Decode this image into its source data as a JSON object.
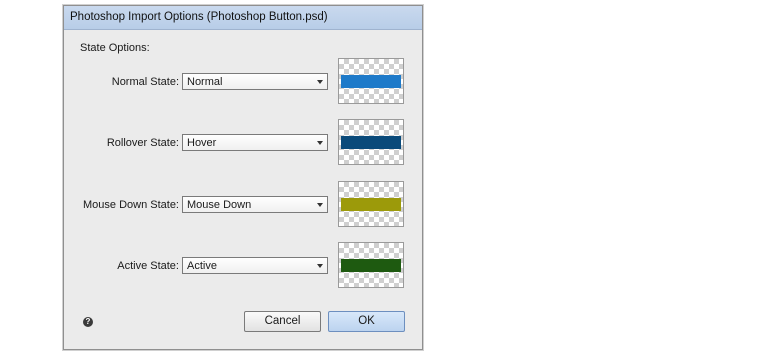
{
  "dialog": {
    "title": "Photoshop Import Options (Photoshop Button.psd)",
    "section_label": "State Options:"
  },
  "states": [
    {
      "label": "Normal State:",
      "value": "Normal",
      "swatch_color": "#1e7ac9"
    },
    {
      "label": "Rollover State:",
      "value": "Hover",
      "swatch_color": "#0a4a7a"
    },
    {
      "label": "Mouse Down State:",
      "value": "Mouse Down",
      "swatch_color": "#9c9a0a"
    },
    {
      "label": "Active State:",
      "value": "Active",
      "swatch_color": "#1e5a10"
    }
  ],
  "footer": {
    "help_icon": "question-circle-icon",
    "cancel_label": "Cancel",
    "ok_label": "OK"
  }
}
